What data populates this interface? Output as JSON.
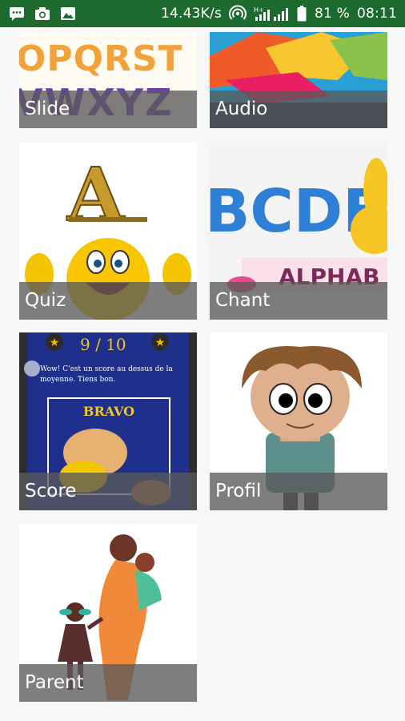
{
  "status_bar": {
    "net_speed": "14.43K/s",
    "battery_percent": "81 %",
    "time": "08:11",
    "left_icons": [
      "message-icon",
      "camera-icon",
      "image-icon"
    ],
    "right_icons": [
      "hotspot-icon",
      "signal-icon",
      "battery-icon"
    ],
    "network_type": "H+"
  },
  "menu": {
    "tiles": [
      {
        "label": "Slide"
      },
      {
        "label": "Audio"
      },
      {
        "label": "Quiz"
      },
      {
        "label": "Chant"
      },
      {
        "label": "Score"
      },
      {
        "label": "Profil"
      },
      {
        "label": "Parent"
      }
    ],
    "slide_letters_top": "OPQRST",
    "slide_letters_bottom": "VWXYZ",
    "quiz_letter": "A",
    "chant_letters": "BCDE",
    "chant_banner": "ALPHAB",
    "score_value": "9 / 10",
    "score_message": "Wow! C'est un score au dessus de la moyenne. Tiens bon.",
    "score_bravo": "BRAVO"
  },
  "colors": {
    "status_bar": "#1d6a2e",
    "background": "#f7f7f7",
    "caption_overlay": "rgba(90,90,90,0.78)"
  }
}
